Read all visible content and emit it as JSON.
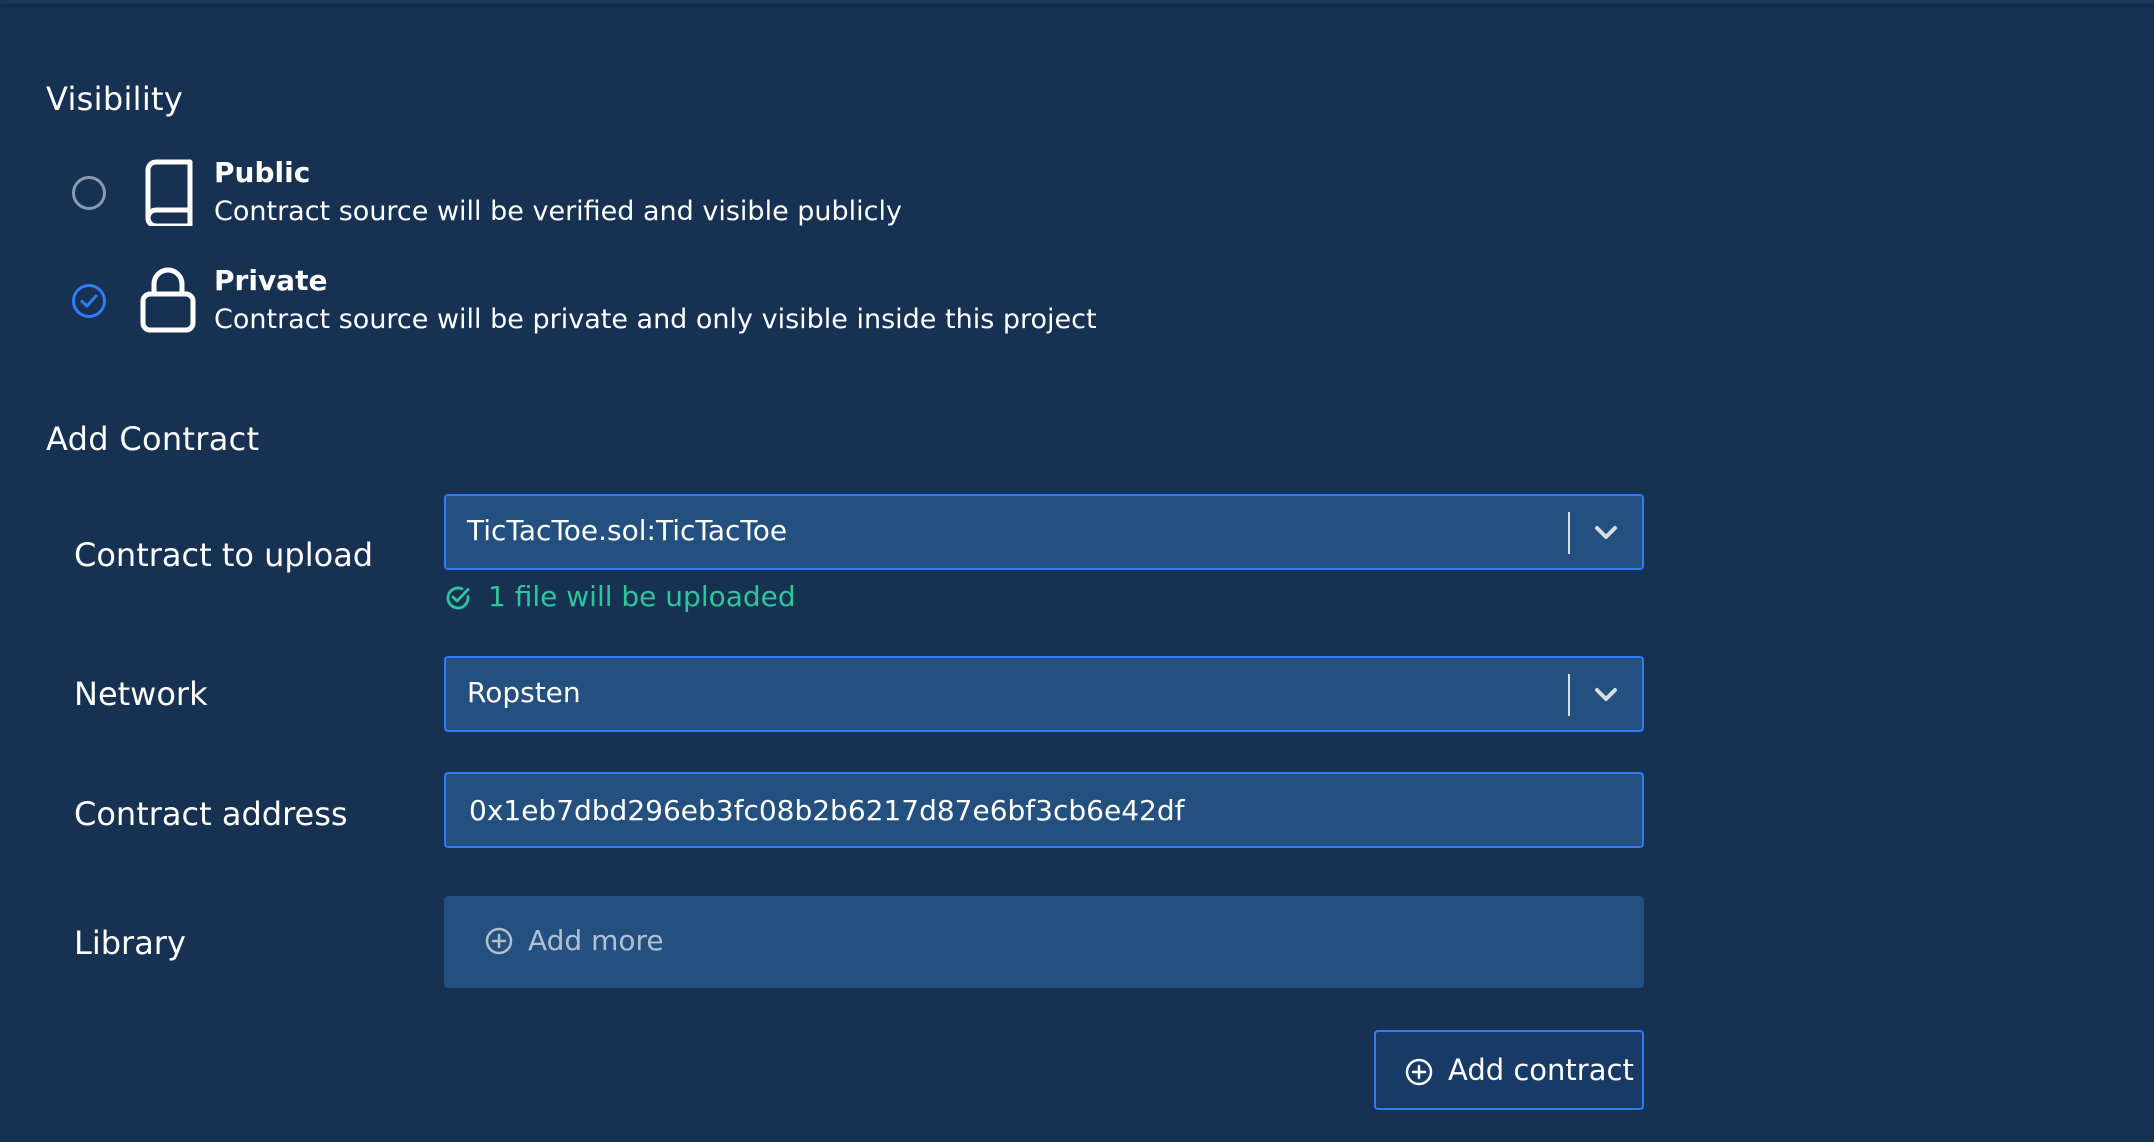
{
  "visibility": {
    "title": "Visibility",
    "options": [
      {
        "title": "Public",
        "description": "Contract source will be verified and visible publicly",
        "icon": "book-icon",
        "selected": false
      },
      {
        "title": "Private",
        "description": "Contract source will be private and only visible inside this project",
        "icon": "lock-icon",
        "selected": true
      }
    ]
  },
  "add_contract": {
    "title": "Add Contract",
    "contract_to_upload": {
      "label": "Contract to upload",
      "value": "TicTacToe.sol:TicTacToe",
      "hint": "1 file will be uploaded"
    },
    "network": {
      "label": "Network",
      "value": "Ropsten"
    },
    "contract_address": {
      "label": "Contract address",
      "value": "0x1eb7dbd296eb3fc08b2b6217d87e6bf3cb6e42df"
    },
    "library": {
      "label": "Library",
      "add_more_label": "Add more"
    },
    "submit_label": "Add contract"
  },
  "colors": {
    "background": "#173152",
    "field_background": "#24507f",
    "accent": "#2f7cf6",
    "success": "#2fc49a"
  }
}
